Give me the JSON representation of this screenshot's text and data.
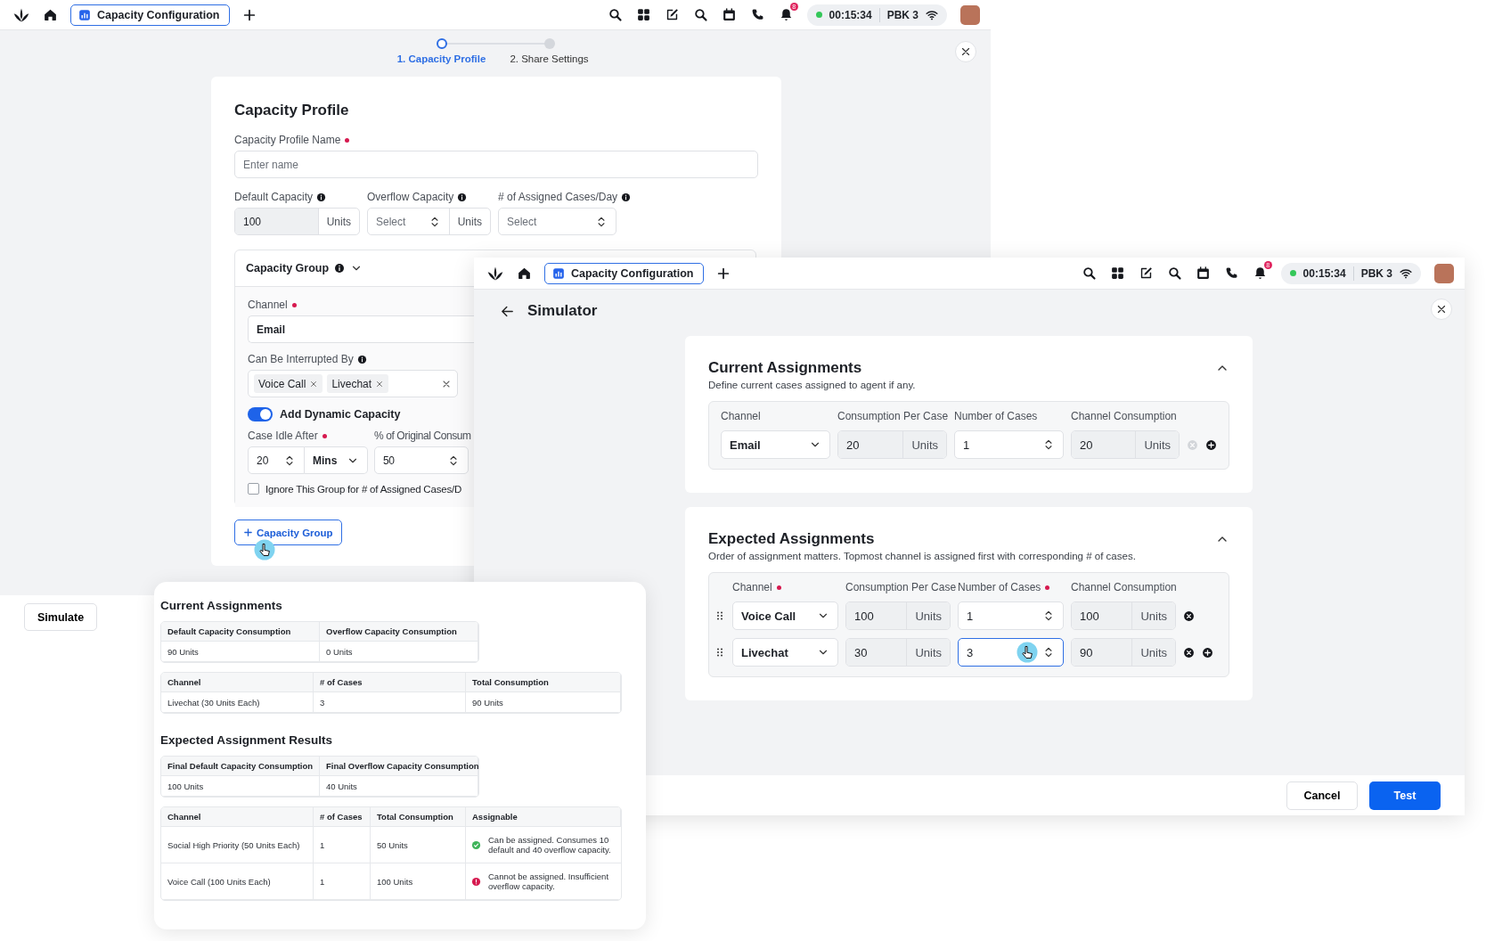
{
  "back_window": {
    "top_bar": {
      "tab_title": "Capacity Configuration",
      "notification_count": "8",
      "timer": "00:15:34",
      "extension": "PBK 3"
    },
    "stepper": [
      {
        "label": "1. Capacity Profile",
        "selected": true
      },
      {
        "label": "2. Share Settings",
        "selected": false
      }
    ],
    "form": {
      "title": "Capacity Profile",
      "profile_name": {
        "label": "Capacity Profile Name",
        "required": true,
        "placeholder": "Enter name"
      },
      "default_capacity": {
        "label": "Default Capacity",
        "info": true,
        "value": "100",
        "unit": "Units"
      },
      "overflow_capacity": {
        "label": "Overflow Capacity",
        "info": true,
        "placeholder": "Select",
        "unit": "Units"
      },
      "assigned_cases": {
        "label": "# of Assigned Cases/Day",
        "info": true,
        "placeholder": "Select"
      },
      "capacity_group": {
        "title": "Capacity Group",
        "info": true,
        "channel": {
          "label": "Channel",
          "required": true,
          "value": "Email"
        },
        "interrupted_by": {
          "label": "Can Be Interrupted By",
          "info": true,
          "tags": [
            "Voice Call",
            "Livechat"
          ]
        },
        "dynamic_capacity": {
          "label": "Add Dynamic Capacity",
          "on": true
        },
        "case_idle": {
          "label": "Case Idle After",
          "required": true,
          "value": "20",
          "unit": "Mins"
        },
        "original_consumption": {
          "label": "% of Original Consum",
          "value": "50"
        },
        "ignore_group": {
          "label": "Ignore This Group for # of Assigned Cases/D",
          "checked": false
        }
      },
      "add_group_button": "Capacity Group"
    }
  },
  "simulate_button": "Simulate",
  "simulator_window": {
    "top_bar": {
      "tab_title": "Capacity Configuration",
      "notification_count": "8",
      "timer": "00:15:34",
      "extension": "PBK 3"
    },
    "title": "Simulator",
    "current_assignments": {
      "title": "Current Assignments",
      "description": "Define current cases assigned to agent if any.",
      "columns": [
        {
          "label": "Channel",
          "required": false
        },
        {
          "label": "Consumption Per Case",
          "required": false
        },
        {
          "label": "Number of Cases",
          "required": false
        },
        {
          "label": "Channel Consumption",
          "required": false
        }
      ],
      "rows": [
        {
          "channel": "Email",
          "consumption": "20",
          "consumption_unit": "Units",
          "cases": "1",
          "channel_consumption": "20",
          "channel_unit": "Units",
          "focused": false,
          "can_remove": false,
          "can_add": true
        }
      ]
    },
    "expected_assignments": {
      "title": "Expected Assignments",
      "description": "Order of assignment matters. Topmost channel is assigned first with corresponding # of cases.",
      "columns": [
        {
          "label": "Channel",
          "required": true
        },
        {
          "label": "Consumption Per Case",
          "required": false
        },
        {
          "label": "Number of Cases",
          "required": true
        },
        {
          "label": "Channel Consumption",
          "required": false
        }
      ],
      "rows": [
        {
          "channel": "Voice Call",
          "consumption": "100",
          "consumption_unit": "Units",
          "cases": "1",
          "channel_consumption": "100",
          "channel_unit": "Units",
          "draggable": true,
          "focused": false,
          "can_remove": true,
          "can_add": false
        },
        {
          "channel": "Livechat",
          "consumption": "30",
          "consumption_unit": "Units",
          "cases": "3",
          "channel_consumption": "90",
          "channel_unit": "Units",
          "draggable": true,
          "focused": true,
          "can_remove": true,
          "can_add": true
        }
      ]
    },
    "cancel_button": "Cancel",
    "test_button": "Test"
  },
  "results_panel": {
    "current_title": "Current Assignments",
    "current_summary": {
      "columns": [
        "Default Capacity Consumption",
        "Overflow Capacity Consumption"
      ],
      "rows": [
        [
          "90 Units",
          "0 Units"
        ]
      ]
    },
    "current_table": {
      "columns": [
        "Channel",
        "# of Cases",
        "Total Consumption"
      ],
      "rows": [
        [
          "Livechat (30 Units Each)",
          "3",
          "90 Units"
        ]
      ]
    },
    "expected_title": "Expected Assignment Results",
    "expected_summary": {
      "columns": [
        "Final Default Capacity Consumption",
        "Final Overflow Capacity Consumption"
      ],
      "rows": [
        [
          "100 Units",
          "40 Units"
        ]
      ]
    },
    "expected_table": {
      "columns": [
        "Channel",
        "# of Cases",
        "Total Consumption",
        "Assignable"
      ],
      "rows": [
        {
          "cells": [
            "Social High Priority (50 Units Each)",
            "1",
            "50 Units"
          ],
          "assignable": {
            "kind": "ok",
            "text": "Can be assigned. Consumes 10 default and 40 overflow capacity."
          }
        },
        {
          "cells": [
            "Voice Call (100 Units Each)",
            "1",
            "100 Units"
          ],
          "assignable": {
            "kind": "error",
            "text": "Cannot be assigned. Insufficient overflow capacity."
          }
        }
      ]
    }
  }
}
